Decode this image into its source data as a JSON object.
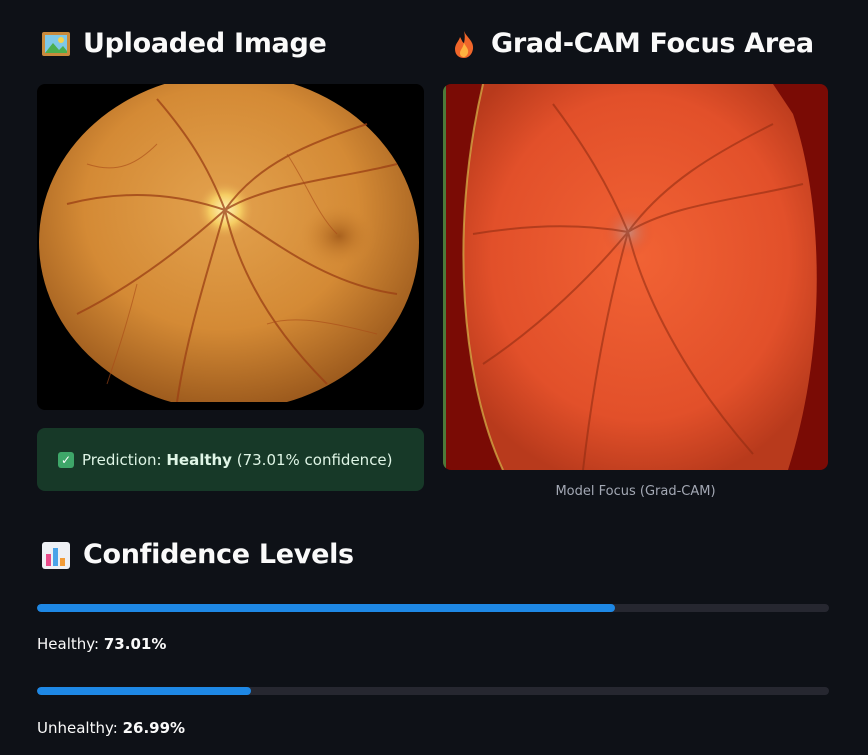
{
  "left_panel": {
    "title": "Uploaded Image",
    "icon": "framed-picture-icon"
  },
  "right_panel": {
    "title": "Grad-CAM Focus Area",
    "icon": "fire-icon",
    "caption": "Model Focus (Grad-CAM)"
  },
  "prediction": {
    "prefix": "Prediction: ",
    "label": "Healthy",
    "suffix": " (73.01% confidence)",
    "icon": "check-mark-icon",
    "color": "#173928"
  },
  "confidence": {
    "title": "Confidence Levels",
    "icon": "bar-chart-icon",
    "accent": "#1e88e5",
    "items": [
      {
        "name": "Healthy: ",
        "value_text": "73.01%",
        "fraction": 0.7301
      },
      {
        "name": "Unhealthy: ",
        "value_text": "26.99%",
        "fraction": 0.2699
      }
    ]
  }
}
